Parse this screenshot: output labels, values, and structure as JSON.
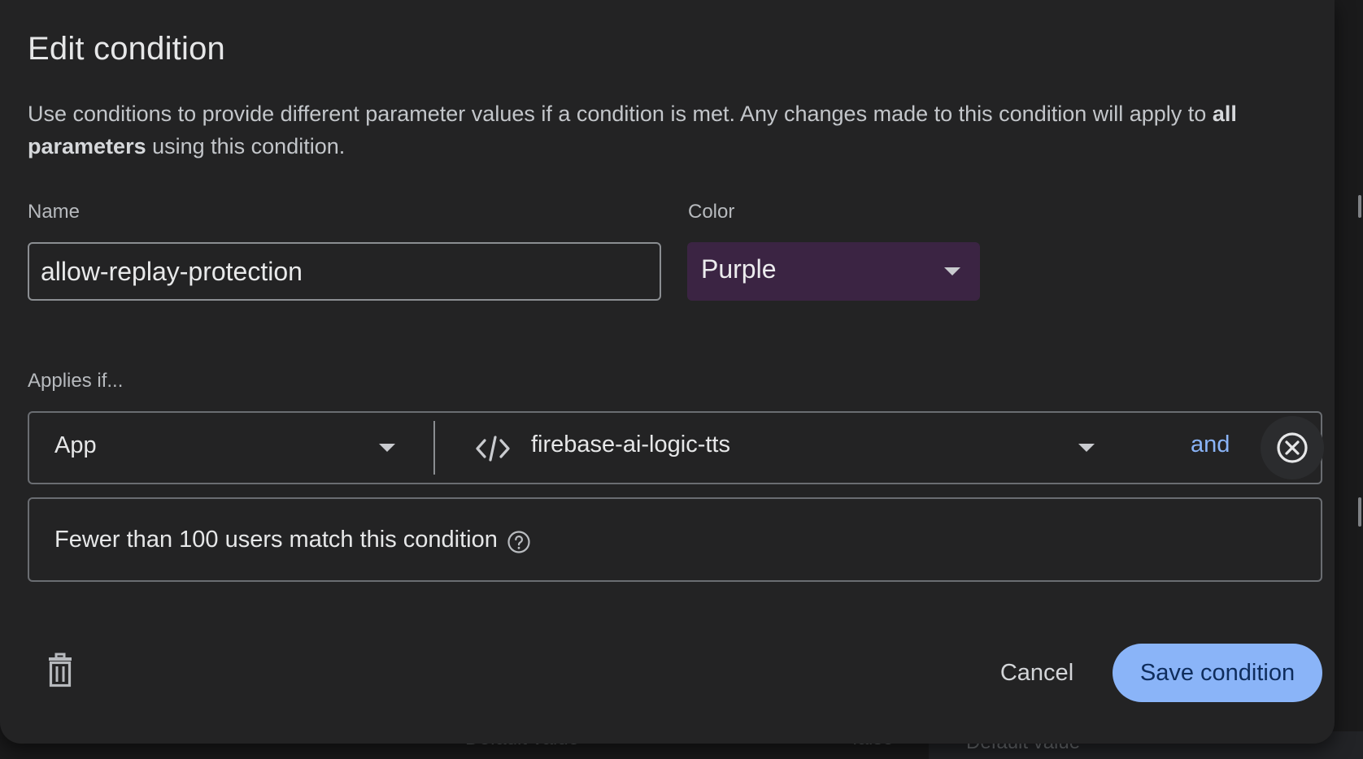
{
  "dialog": {
    "title": "Edit condition",
    "description_prefix": "Use conditions to provide different parameter values if a condition is met. Any changes made to this condition will apply to ",
    "description_bold": "all parameters",
    "description_suffix": " using this condition."
  },
  "name_field": {
    "label": "Name",
    "value": "allow-replay-protection"
  },
  "color_field": {
    "label": "Color",
    "value": "Purple",
    "swatch_color": "#3b2443"
  },
  "applies": {
    "label": "Applies if...",
    "rule": {
      "type": "App",
      "value": "firebase-ai-logic-tts",
      "and_label": "and"
    }
  },
  "match_info": {
    "text": "Fewer than 100 users match this condition"
  },
  "actions": {
    "cancel_label": "Cancel",
    "save_label": "Save condition",
    "accent_color": "#8ab4f8"
  },
  "background": {
    "left_label": "Default value",
    "mid_value": "false",
    "right_label": "Default value"
  }
}
